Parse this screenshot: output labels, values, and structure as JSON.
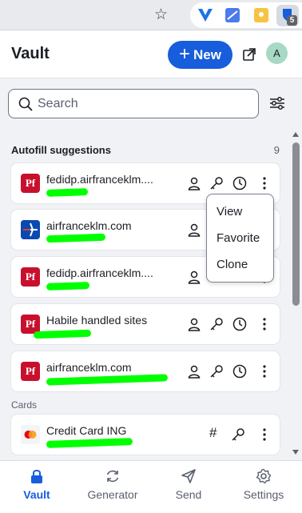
{
  "header": {
    "title": "Vault",
    "new_label": "New",
    "avatar_initial": "A"
  },
  "search": {
    "placeholder": "Search"
  },
  "autofill": {
    "title": "Autofill suggestions",
    "count": "9",
    "items": [
      {
        "name": "fedidp.airfranceklm....",
        "logo": "Pf"
      },
      {
        "name": "airfranceklm.com",
        "logo": ""
      },
      {
        "name": "fedidp.airfranceklm....",
        "logo": "Pf"
      },
      {
        "name": "Habile handled sites",
        "logo": "Pf"
      },
      {
        "name": "airfranceklm.com",
        "logo": "Pf"
      }
    ]
  },
  "cards": {
    "title": "Cards",
    "items": [
      {
        "name": "Credit Card ING"
      }
    ]
  },
  "context_menu": {
    "items": [
      "View",
      "Favorite",
      "Clone"
    ]
  },
  "nav": {
    "items": [
      {
        "label": "Vault",
        "active": true
      },
      {
        "label": "Generator"
      },
      {
        "label": "Send"
      },
      {
        "label": "Settings"
      }
    ]
  },
  "colors": {
    "primary": "#175ddc",
    "redaction": "#00ff00",
    "pf_red": "#c8102e"
  },
  "icons": [
    "star-icon",
    "extension-icon",
    "search-icon",
    "filter-icon",
    "popout-icon",
    "user-icon",
    "key-icon",
    "clock-icon",
    "kebab-icon",
    "hash-icon",
    "lock-icon",
    "refresh-icon",
    "send-icon",
    "gear-icon"
  ]
}
